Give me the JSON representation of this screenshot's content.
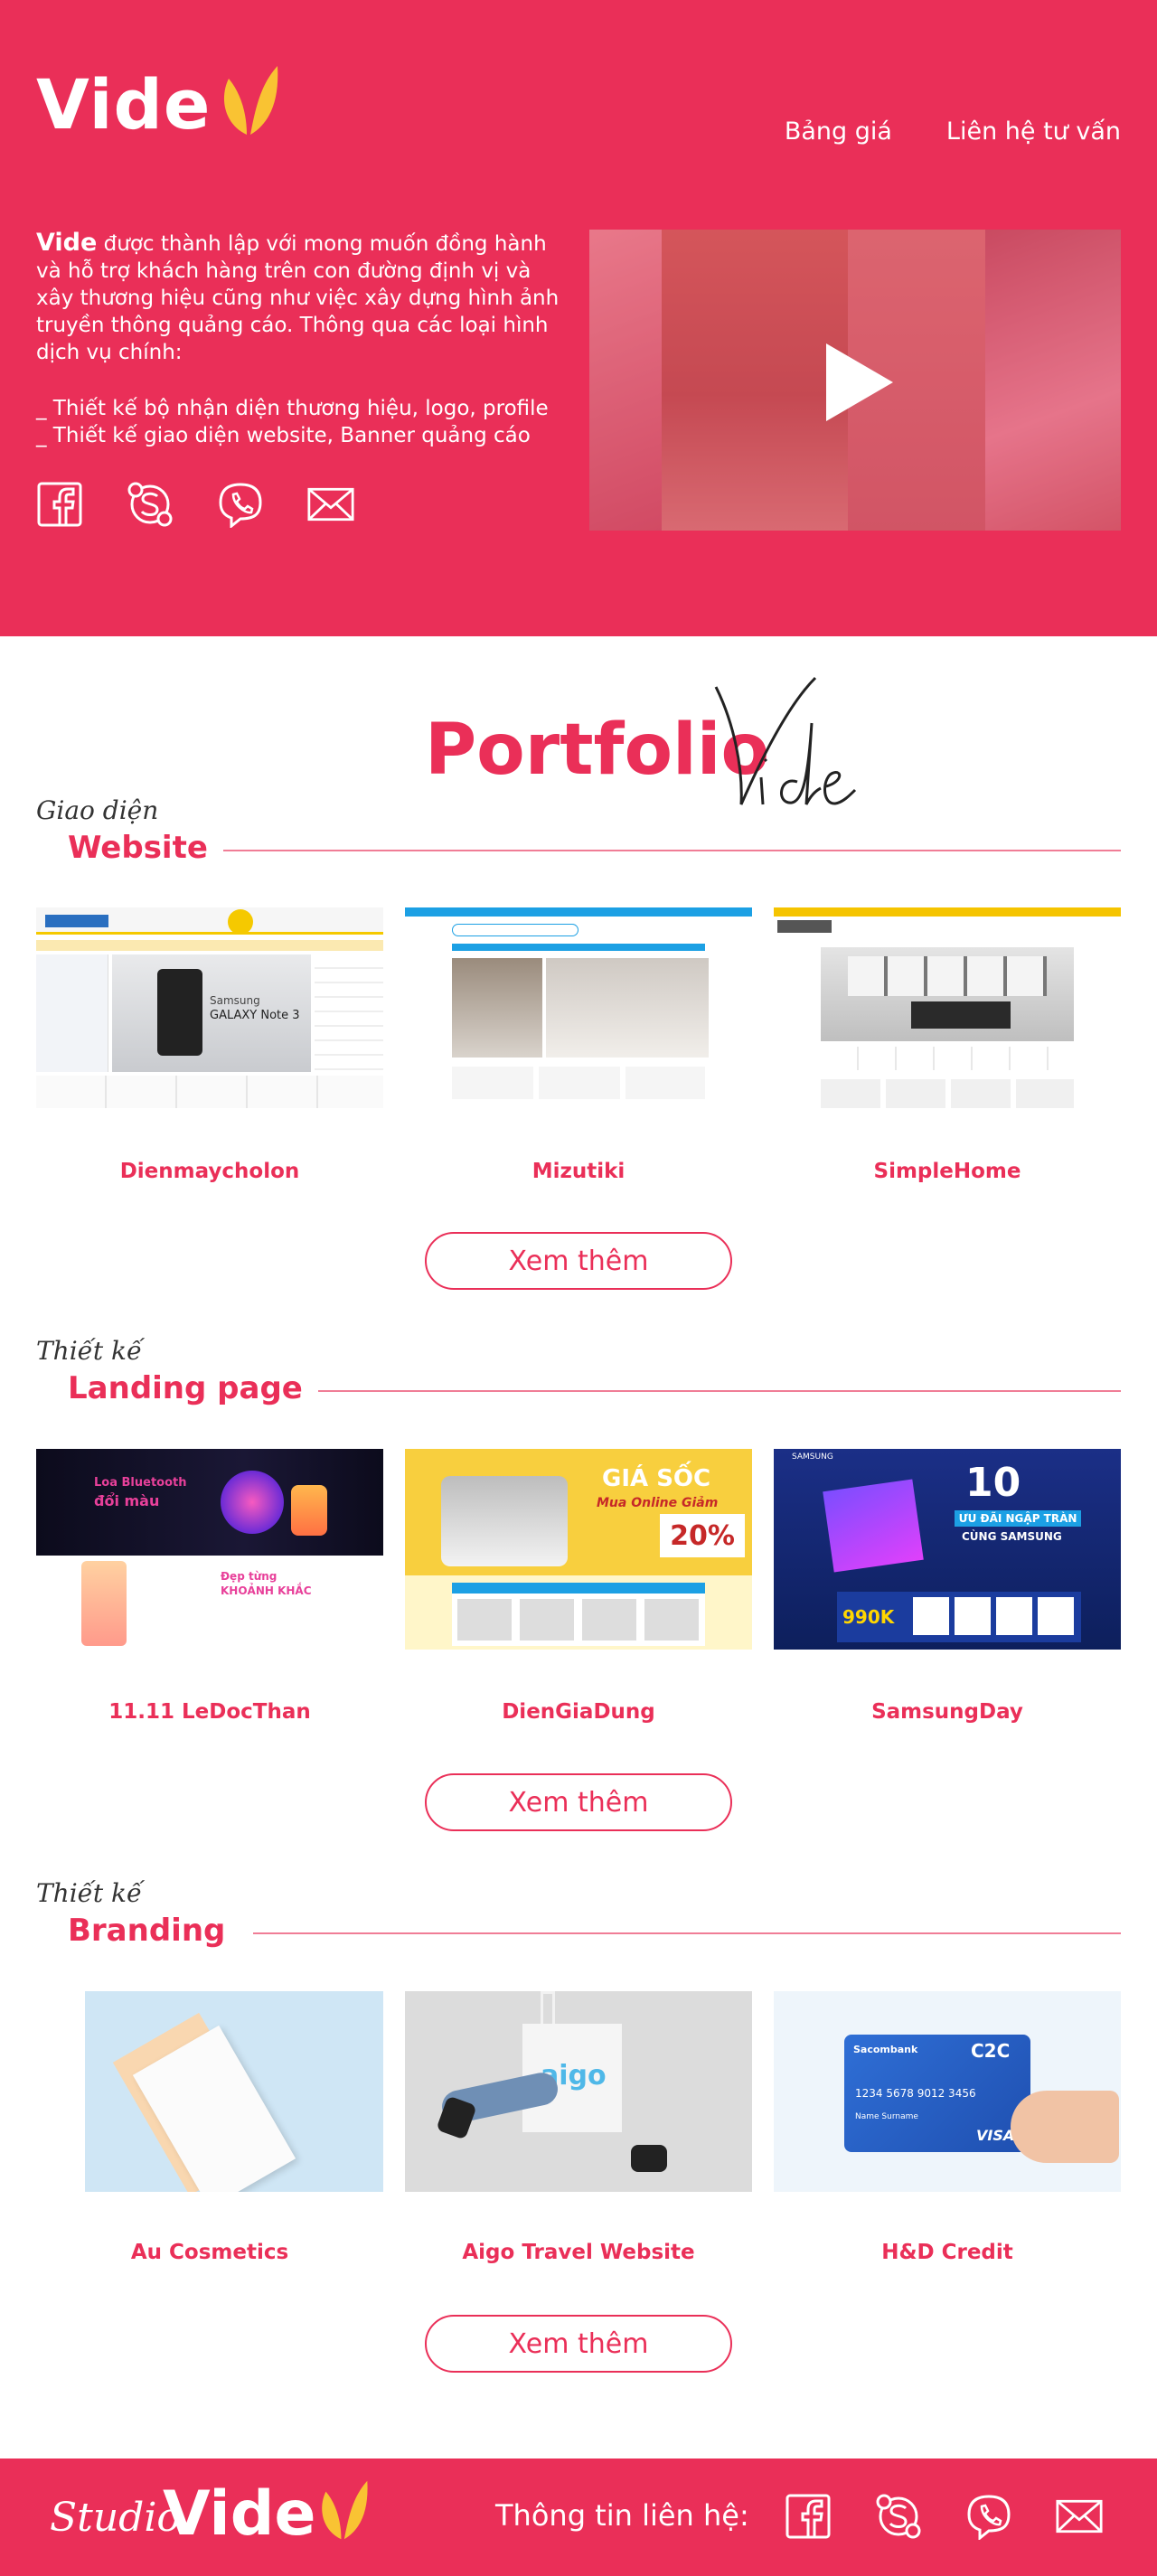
{
  "brand": {
    "name": "Vide",
    "accent": "#ea2f58",
    "leaf_color": "#f9c333"
  },
  "nav": {
    "items": [
      "Bảng giá",
      "Liên hệ tư vấn"
    ]
  },
  "hero": {
    "brand_word": "Vide",
    "intro": " được thành lập với mong muốn đồng hành và hỗ trợ khách hàng trên con đường định vị và xây thương hiệu cũng như việc xây dựng hình ảnh truyền thông quảng cáo. Thông qua các loại hình dịch vụ chính:",
    "services": [
      "_ Thiết kế bộ nhận diện thương hiệu, logo, profile",
      "_ Thiết kế giao diện website, Banner quảng cáo"
    ],
    "socials": [
      "facebook-icon",
      "skype-icon",
      "viber-icon",
      "mail-icon"
    ],
    "video_icon": "play-icon"
  },
  "portfolio": {
    "title": "Portfolio",
    "script": "Vide"
  },
  "sections": [
    {
      "script": "Giao diện",
      "title": "Website",
      "items": [
        "Dienmaycholon",
        "Mizutiki",
        "SimpleHome"
      ],
      "more": "Xem thêm"
    },
    {
      "script": "Thiết kế",
      "title": "Landing page",
      "items": [
        "11.11 LeDocThan",
        "DienGiaDung",
        "SamsungDay"
      ],
      "more": "Xem thêm"
    },
    {
      "script": "Thiết kế",
      "title": "Branding",
      "items": [
        "Au Cosmetics",
        "Aigo Travel Website",
        "H&D Credit"
      ],
      "more": "Xem thêm"
    }
  ],
  "thumb_text": {
    "samsung": "Samsung",
    "note3": "GALAXY Note 3",
    "loa": "Loa Bluetooth",
    "doi_mau": "đổi màu",
    "dep_tung": "Đẹp từng",
    "khoanh_khac": "KHOẢNH KHẮC",
    "gia_soc": "GIÁ SỐC",
    "mua_online": "Mua Online Giảm",
    "pct": "20%",
    "samsung_brand": "SAMSUNG",
    "ten": "10",
    "uu_dai": "ƯU ĐÃI NGẬP TRÀN",
    "cung_samsung": "CÙNG SAMSUNG",
    "price": "990K",
    "aigo": "aigo",
    "bank": "Sacombank",
    "c2c": "C2C",
    "card_number": "1234  5678  9012  3456",
    "card_name": "Name Surname",
    "visa": "VISA"
  },
  "footer": {
    "studio": "Studio",
    "brand": "Vide",
    "contact_label": "Thông tin liên hệ:",
    "socials": [
      "facebook-icon",
      "skype-icon",
      "viber-icon",
      "mail-icon"
    ]
  }
}
